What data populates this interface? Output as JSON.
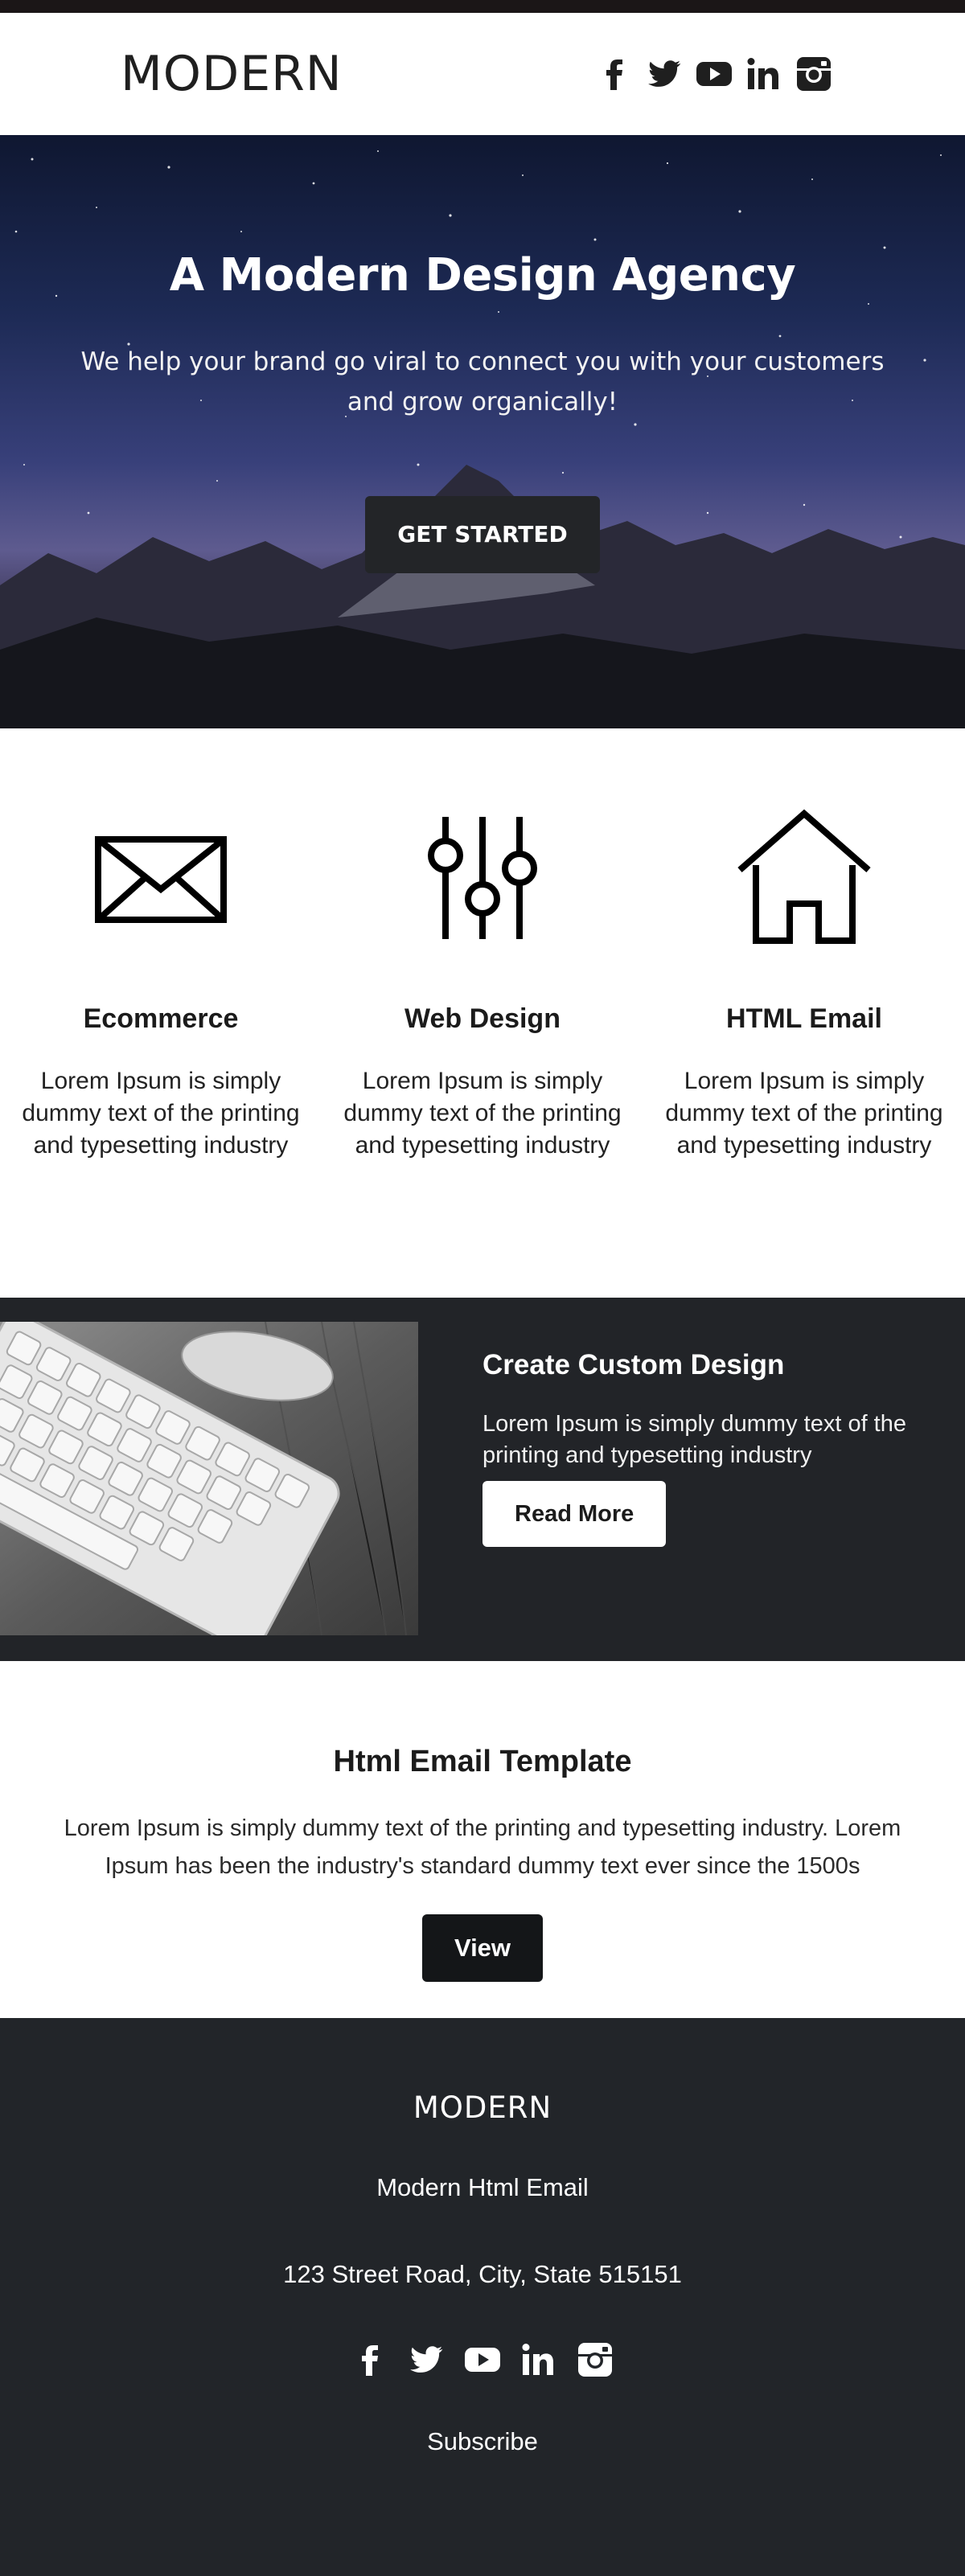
{
  "header": {
    "logo": "MODERN",
    "social_icons": [
      "facebook-icon",
      "twitter-icon",
      "youtube-icon",
      "linkedin-icon",
      "instagram-icon"
    ]
  },
  "hero": {
    "title": "A Modern Design Agency",
    "subtitle": "We help your brand go viral to connect you with your customers and grow organically!",
    "cta": "GET STARTED"
  },
  "services": [
    {
      "icon": "envelope-icon",
      "title": "Ecommerce",
      "text": "Lorem Ipsum is simply dummy text of the printing and typesetting industry"
    },
    {
      "icon": "sliders-icon",
      "title": "Web Design",
      "text": "Lorem Ipsum is simply dummy text of the printing and typesetting industry"
    },
    {
      "icon": "house-icon",
      "title": "HTML Email",
      "text": "Lorem Ipsum is simply dummy text of the printing and typesetting industry"
    }
  ],
  "promo": {
    "image": "keyboard-mouse-photo",
    "title": "Create Custom Design",
    "text": "Lorem Ipsum is simply dummy text of the printing and typesetting industry",
    "button": "Read More"
  },
  "template": {
    "title": "Html Email Template",
    "text": "Lorem Ipsum is simply dummy text of the printing and typesetting industry. Lorem Ipsum has been the industry's standard dummy text ever since the 1500s",
    "button": "View"
  },
  "footer": {
    "logo": "MODERN",
    "tagline": "Modern Html Email",
    "address": "123 Street Road, City, State 515151",
    "subscribe": "Subscribe"
  },
  "colors": {
    "dark": "#222428",
    "top_bar": "#1b1617",
    "button_dark": "#232528",
    "button_black": "#141618"
  }
}
